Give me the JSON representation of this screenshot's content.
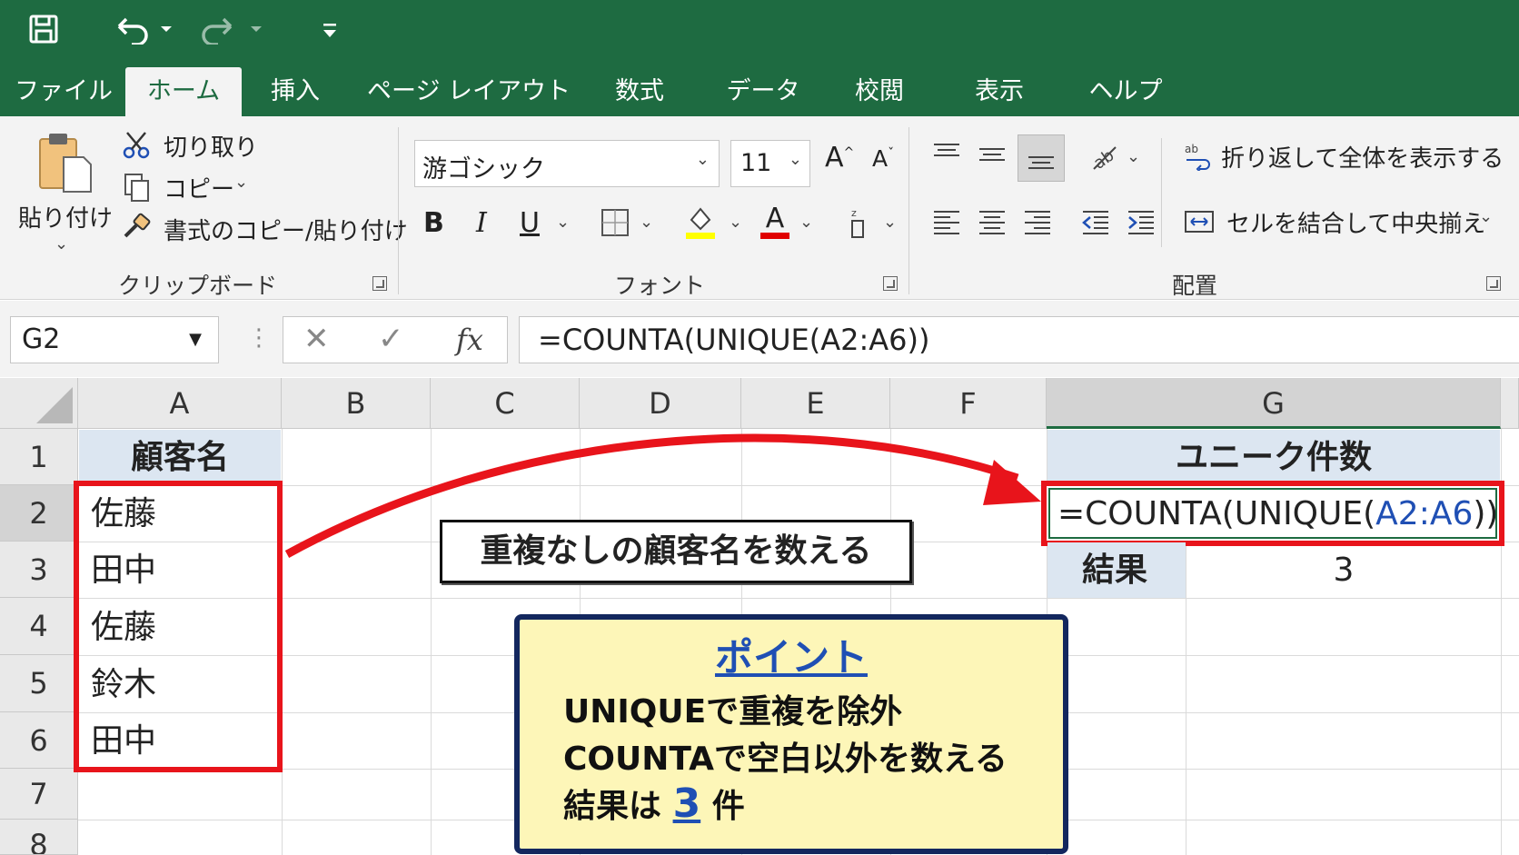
{
  "quick_access": {
    "icons": [
      "save-icon",
      "undo-icon",
      "redo-icon",
      "customize-icon"
    ]
  },
  "tabs": [
    "ファイル",
    "ホーム",
    "挿入",
    "ページ レイアウト",
    "数式",
    "データ",
    "校閲",
    "表示",
    "ヘルプ"
  ],
  "active_tab": "ホーム",
  "ribbon": {
    "clipboard": {
      "paste": "貼り付け",
      "cut": "切り取り",
      "copy": "コピー",
      "format_painter": "書式のコピー/貼り付け",
      "group_label": "クリップボード"
    },
    "font": {
      "font_name": "游ゴシック",
      "font_size": "11",
      "bold": "B",
      "italic": "I",
      "underline": "U",
      "font_color_letter": "A",
      "grow_font": "A",
      "shrink_font": "A",
      "group_label": "フォント",
      "fill_color": "#ffff00",
      "font_color": "#e00000"
    },
    "alignment": {
      "wrap_text": "折り返して全体を表示する",
      "merge_center": "セルを結合して中央揃え",
      "group_label": "配置"
    }
  },
  "formula_bar": {
    "name_box": "G2",
    "formula": "=COUNTA(UNIQUE(A2:A6))",
    "fx": "fx"
  },
  "sheet": {
    "columns": [
      "A",
      "B",
      "C",
      "D",
      "E",
      "F",
      "G"
    ],
    "selected_column": "G",
    "rows": [
      "1",
      "2",
      "3",
      "4",
      "5",
      "6",
      "7",
      "8"
    ],
    "selected_row": "2",
    "header_a1": "顧客名",
    "names": [
      "佐藤",
      "田中",
      "佐藤",
      "鈴木",
      "田中"
    ],
    "g1": "ユニーク件数",
    "g2_prefix": "=COUNTA(UNIQUE(",
    "g2_ref": "A2:A6",
    "g2_suffix": "))",
    "f3_label": "結果",
    "g3_value": "3"
  },
  "annotation": {
    "callout": "重複なしの顧客名を数える",
    "point_title": "ポイント",
    "point_line1": "UNIQUEで重複を除外",
    "point_line2": "COUNTAで空白以外を数える",
    "point_line3_prefix": "結果は",
    "point_line3_value": "3",
    "point_line3_suffix": "件"
  },
  "colors": {
    "excel_green": "#1e6b41",
    "header_fill": "#dce6f1",
    "highlight_red": "#e8141b",
    "ref_blue": "#1f4fb4",
    "point_box_fill": "#fdf6b8",
    "point_box_border": "#13275e"
  }
}
